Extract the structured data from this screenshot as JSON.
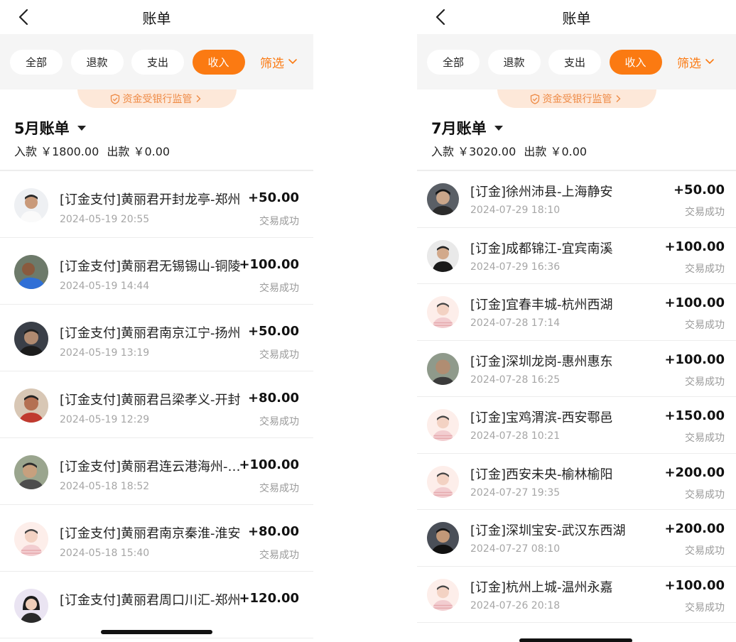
{
  "left": {
    "nav_title": "账单",
    "filters": [
      {
        "label": "全部"
      },
      {
        "label": "退款"
      },
      {
        "label": "支出"
      },
      {
        "label": "收入"
      }
    ],
    "active_filter": "收入",
    "screen_label": "筛选",
    "supervise_label": "资金受银行监管",
    "month_label": "5月账单",
    "income_text": "入款 ￥1800.00",
    "outgo_text": "出款 ￥0.00",
    "transactions": [
      {
        "name": "[订金支付]黄丽君开封龙亭-郑州",
        "date": "2024-05-19 20:55",
        "amount": "+50.00",
        "status": "交易成功"
      },
      {
        "name": "[订金支付]黄丽君无锡锡山-铜陵",
        "date": "2024-05-19 14:44",
        "amount": "+100.00",
        "status": "交易成功"
      },
      {
        "name": "[订金支付]黄丽君南京江宁-扬州",
        "date": "2024-05-19 13:19",
        "amount": "+50.00",
        "status": "交易成功"
      },
      {
        "name": "[订金支付]黄丽君吕梁孝义-开封",
        "date": "2024-05-19 12:29",
        "amount": "+80.00",
        "status": "交易成功"
      },
      {
        "name": "[订金支付]黄丽君连云港海州-徐州",
        "date": "2024-05-18 18:52",
        "amount": "+100.00",
        "status": "交易成功"
      },
      {
        "name": "[订金支付]黄丽君南京秦淮-淮安",
        "date": "2024-05-18 15:40",
        "amount": "+80.00",
        "status": "交易成功"
      },
      {
        "name": "[订金支付]黄丽君周口川汇-郑州",
        "date": "",
        "amount": "+120.00",
        "status": ""
      }
    ]
  },
  "right": {
    "nav_title": "账单",
    "filters": [
      {
        "label": "全部"
      },
      {
        "label": "退款"
      },
      {
        "label": "支出"
      },
      {
        "label": "收入"
      }
    ],
    "active_filter": "收入",
    "screen_label": "筛选",
    "supervise_label": "资金受银行监管",
    "month_label": "7月账单",
    "income_text": "入款 ￥3020.00",
    "outgo_text": "出款 ￥0.00",
    "transactions": [
      {
        "name": "[订金]徐州沛县-上海静安",
        "date": "2024-07-29 18:10",
        "amount": "+50.00",
        "status": "交易成功"
      },
      {
        "name": "[订金]成都锦江-宜宾南溪",
        "date": "2024-07-29 16:36",
        "amount": "+100.00",
        "status": "交易成功"
      },
      {
        "name": "[订金]宜春丰城-杭州西湖",
        "date": "2024-07-28 17:14",
        "amount": "+100.00",
        "status": "交易成功"
      },
      {
        "name": "[订金]深圳龙岗-惠州惠东",
        "date": "2024-07-28 16:25",
        "amount": "+100.00",
        "status": "交易成功"
      },
      {
        "name": "[订金]宝鸡渭滨-西安鄠邑",
        "date": "2024-07-28 10:21",
        "amount": "+150.00",
        "status": "交易成功"
      },
      {
        "name": "[订金]西安未央-榆林榆阳",
        "date": "2024-07-27 19:35",
        "amount": "+200.00",
        "status": "交易成功"
      },
      {
        "name": "[订金]深圳宝安-武汉东西湖",
        "date": "2024-07-27 08:10",
        "amount": "+200.00",
        "status": "交易成功"
      },
      {
        "name": "[订金]杭州上城-温州永嘉",
        "date": "2024-07-26 20:18",
        "amount": "+100.00",
        "status": "交易成功"
      }
    ]
  },
  "colors": {
    "accent": "#fb7a12",
    "supervise_bg": "#fde8d9",
    "supervise_text": "#ee8a45"
  },
  "icons": {
    "back": "chevron-left-icon",
    "filter_arrow": "chevron-down-icon",
    "shield": "shield-check-icon",
    "month_caret": "caret-down-icon"
  }
}
